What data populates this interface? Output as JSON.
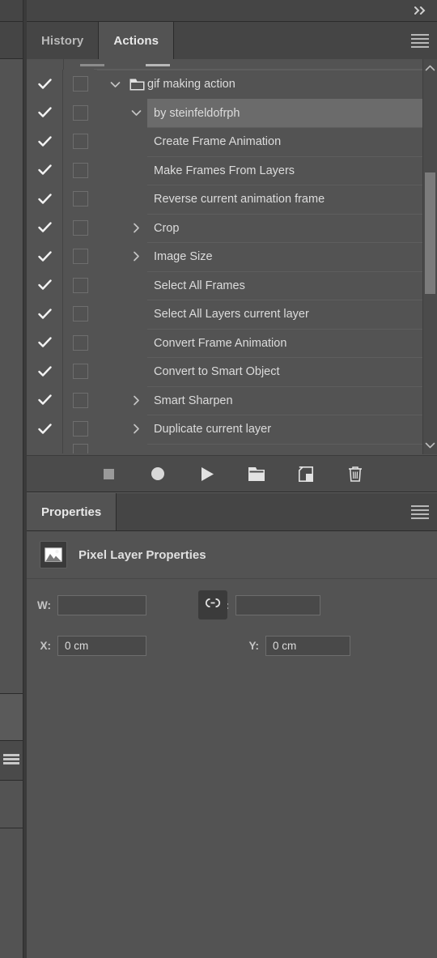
{
  "window": {
    "collapse_icon": "double-chevron-right-icon",
    "panel_menu_icon": "hamburger-menu-icon"
  },
  "actions_panel": {
    "tabs": [
      {
        "label": "History",
        "active": false
      },
      {
        "label": "Actions",
        "active": true
      }
    ],
    "rows": [
      {
        "label": "gif making action",
        "checked": true,
        "toggle": false,
        "indent": 0,
        "disclosure": "down",
        "icon": "folder-icon",
        "selected": false
      },
      {
        "label": "by steinfeldofrph",
        "checked": true,
        "toggle": false,
        "indent": 1,
        "disclosure": "down",
        "icon": null,
        "selected": true
      },
      {
        "label": "Create Frame Animation",
        "checked": true,
        "toggle": false,
        "indent": 2,
        "disclosure": "none",
        "icon": null,
        "selected": false
      },
      {
        "label": "Make Frames From Layers",
        "checked": true,
        "toggle": false,
        "indent": 2,
        "disclosure": "none",
        "icon": null,
        "selected": false
      },
      {
        "label": "Reverse current animation frame",
        "checked": true,
        "toggle": false,
        "indent": 2,
        "disclosure": "none",
        "icon": null,
        "selected": false
      },
      {
        "label": "Crop",
        "checked": true,
        "toggle": false,
        "indent": 2,
        "disclosure": "right",
        "icon": null,
        "selected": false
      },
      {
        "label": "Image Size",
        "checked": true,
        "toggle": false,
        "indent": 2,
        "disclosure": "right",
        "icon": null,
        "selected": false
      },
      {
        "label": "Select All Frames",
        "checked": true,
        "toggle": false,
        "indent": 2,
        "disclosure": "none",
        "icon": null,
        "selected": false
      },
      {
        "label": "Select All Layers current layer",
        "checked": true,
        "toggle": false,
        "indent": 2,
        "disclosure": "none",
        "icon": null,
        "selected": false
      },
      {
        "label": "Convert Frame Animation",
        "checked": true,
        "toggle": false,
        "indent": 2,
        "disclosure": "none",
        "icon": null,
        "selected": false
      },
      {
        "label": "Convert to Smart Object",
        "checked": true,
        "toggle": false,
        "indent": 2,
        "disclosure": "none",
        "icon": null,
        "selected": false
      },
      {
        "label": "Smart Sharpen",
        "checked": true,
        "toggle": false,
        "indent": 2,
        "disclosure": "right",
        "icon": null,
        "selected": false
      },
      {
        "label": "Duplicate current layer",
        "checked": true,
        "toggle": false,
        "indent": 2,
        "disclosure": "right",
        "icon": null,
        "selected": false
      }
    ],
    "scrollbar": {
      "up_arrow": "chevron-up-icon",
      "down_arrow": "chevron-down-icon"
    },
    "toolbar": [
      {
        "name": "stop-button",
        "icon": "stop-square-icon"
      },
      {
        "name": "record-button",
        "icon": "record-circle-icon"
      },
      {
        "name": "play-button",
        "icon": "play-triangle-icon"
      },
      {
        "name": "new-set-button",
        "icon": "folder-icon"
      },
      {
        "name": "new-action-button",
        "icon": "new-page-icon"
      },
      {
        "name": "delete-button",
        "icon": "trash-icon"
      }
    ]
  },
  "properties_panel": {
    "tab_label": "Properties",
    "panel_menu_icon": "hamburger-menu-icon",
    "header_icon": "pixel-layer-thumbnail-icon",
    "header_title": "Pixel Layer Properties",
    "fields": {
      "w_label": "W:",
      "w_value": "",
      "w_placeholder": "",
      "h_label": "H:",
      "h_value": "",
      "h_placeholder": "",
      "x_label": "X:",
      "x_value": "0 cm",
      "y_label": "Y:",
      "y_value": "0 cm",
      "link_icon": "link-chain-icon"
    }
  },
  "colors": {
    "panel_bg": "#535353",
    "header_bg": "#454545",
    "toolbar_bg": "#4b4b4b",
    "selected_row": "#6b6b6b",
    "text": "#dcdcdc",
    "field_bg": "#494949"
  }
}
